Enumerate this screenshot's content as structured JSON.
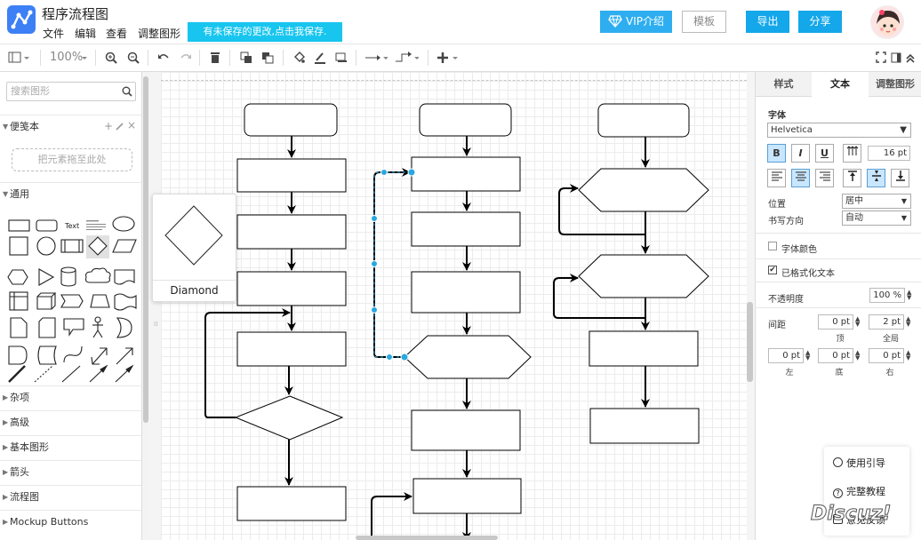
{
  "header": {
    "title": "程序流程图",
    "menus": [
      "文件",
      "编辑",
      "查看",
      "调整图形"
    ],
    "unsaved_banner": "有未保存的更改,点击我保存.",
    "vip": "VIP介绍",
    "template": "模板",
    "export": "导出",
    "share": "分享"
  },
  "toolbar": {
    "zoom": "100%"
  },
  "sidebar": {
    "search_placeholder": "搜索图形",
    "scratchpad": "便笺本",
    "drop_hint": "把元素拖至此处",
    "general": "通用",
    "shape_text": "Text",
    "sections": [
      "杂项",
      "高级",
      "基本图形",
      "箭头",
      "流程图",
      "Mockup Buttons"
    ]
  },
  "tooltip": {
    "label": "Diamond"
  },
  "right_panel": {
    "tabs": [
      "样式",
      "文本",
      "调整图形"
    ],
    "font_heading": "字体",
    "font_family": "Helvetica",
    "bold": "B",
    "italic": "I",
    "underline": "U",
    "font_size": "16 pt",
    "position_label": "位置",
    "position_value": "居中",
    "direction_label": "书写方向",
    "direction_value": "自动",
    "font_color": "字体颜色",
    "formatted_text": "已格式化文本",
    "opacity_label": "不透明度",
    "opacity_value": "100 %",
    "spacing_label": "间距",
    "spacing_top": "0 pt",
    "spacing_global": "2 pt",
    "spacing_left": "0 pt",
    "spacing_bottom": "0 pt",
    "spacing_right": "0 pt",
    "sub_top": "顶",
    "sub_global": "全局",
    "sub_left": "左",
    "sub_bottom": "底",
    "sub_right": "右"
  },
  "help": {
    "guide": "使用引导",
    "tutorial": "完整教程",
    "feedback": "意见反馈"
  },
  "watermark": "Discuz!",
  "colors": {
    "accent": "#14a7ea",
    "selection": "#29a8e0"
  }
}
